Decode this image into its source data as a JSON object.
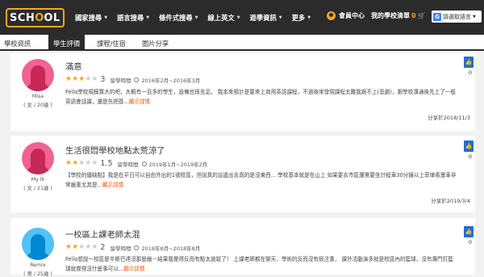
{
  "header": {
    "logo_text": "SCH",
    "logo_o": "O",
    "logo_end": "OL",
    "nav": [
      {
        "label": "國家搜尋"
      },
      {
        "label": "語言搜尋"
      },
      {
        "label": "條件式搜尋"
      },
      {
        "label": "線上英文"
      },
      {
        "label": "遊學資訊"
      },
      {
        "label": "更多"
      }
    ],
    "member_center": "會員中心",
    "my_school_list": "我的學校清單",
    "favorites_count": "0",
    "translate_label": "請選取語言"
  },
  "tabs": [
    {
      "label": "學校資訊"
    },
    {
      "label": "學生評價"
    },
    {
      "label": "課程/住宿"
    },
    {
      "label": "圖片分享"
    }
  ],
  "reviews": [
    {
      "title": "滿意",
      "user": "Misa",
      "user_meta": "( 女 / 20歲 )",
      "rating": "3",
      "stay_label": "留學時間",
      "stay": "2016年2月~2016年3月",
      "body": "Fella學校規模算大的吧，大概有一百多的學生，設備也很充足。 我本來預計是要來上商用英語課程，不過後來發現課程太難我跟不上(悲劇)，跟學校溝通後先上了一般英語會話課，還是先把基...",
      "more": "顯示詳情",
      "shared": "分享於2018/11/3",
      "likes": "0"
    },
    {
      "title": "生活很悶學校地點太荒涼了",
      "user": "My lk",
      "user_meta": "( 女 / 21歲 )",
      "rating": "1.5",
      "stay_label": "留學時間",
      "stay": "2019年1月~2019年2月",
      "body": "【學校的優缺點】我是在平日可以自由外出的1號校區，但說真的這邊出去真的是沒東西... 學校基本就是在山上 如果要去市區還需要坐計程車30分鐘以上菲律賓塞車非常嚴重尤其是...",
      "more": "顯示詳情",
      "shared": "分享於2019/3/4",
      "likes": "0"
    },
    {
      "title": "一校區上課老師太混",
      "user": "Remix",
      "user_meta": "( 男 / 25歲 )",
      "rating": "2",
      "stay_label": "留學時間",
      "stay": "2018年8月~2018年8月",
      "body": "Fella想說一校區是半斯巴達沒那麼嚴－結果我覺得反而有點太過鬆了！ 上課老師都在聊天、學術的反而沒有很注重， 課外活動演多就是校區內的籃球，沒有專門打籃球就覺得沒什麼事可以...",
      "more": "顯示詳情",
      "shared": "",
      "likes": "0"
    }
  ],
  "colors": {
    "topbar": "#2b2b2b",
    "accent": "#f5a623",
    "like": "#1e6fd9",
    "more_link": "#e65100"
  }
}
